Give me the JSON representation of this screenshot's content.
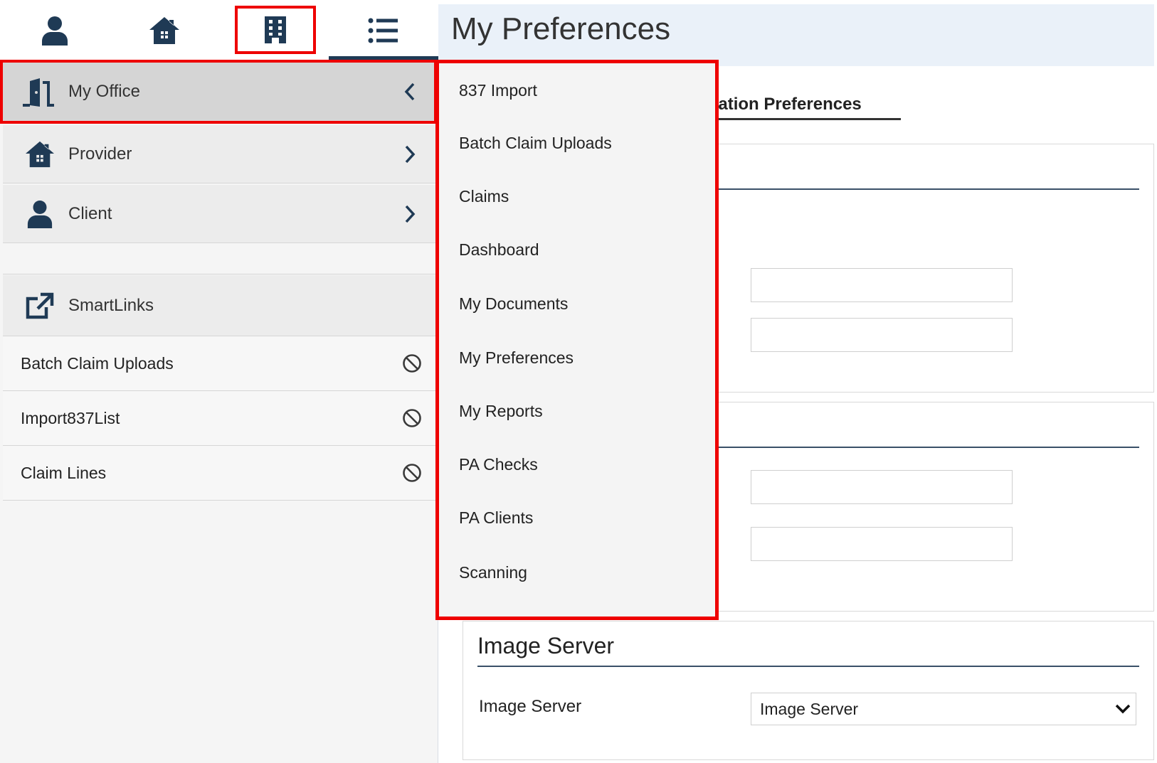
{
  "app": {
    "page_title": "My Preferences"
  },
  "top_icons": [
    {
      "name": "person-icon"
    },
    {
      "name": "house-icon"
    },
    {
      "name": "building-icon",
      "selected": true
    },
    {
      "name": "list-icon",
      "active_tab": true
    }
  ],
  "nav": {
    "items": [
      {
        "label": "My Office",
        "icon": "office-door-icon",
        "chevron": "chevron-left",
        "expanded": true
      },
      {
        "label": "Provider",
        "icon": "house-icon",
        "chevron": "chevron-right"
      },
      {
        "label": "Client",
        "icon": "person-icon",
        "chevron": "chevron-right"
      }
    ],
    "smartlinks": {
      "label": "SmartLinks",
      "icon": "external-link-icon",
      "items": [
        {
          "label": "Batch Claim Uploads",
          "icon": "ban-icon"
        },
        {
          "label": "Import837List",
          "icon": "ban-icon"
        },
        {
          "label": "Claim Lines",
          "icon": "ban-icon"
        }
      ]
    }
  },
  "submenu": {
    "items": [
      "837 Import",
      "Batch Claim Uploads",
      "Claims",
      "Dashboard",
      "My Documents",
      "My Preferences",
      "My Reports",
      "PA Checks",
      "PA Clients",
      "Scanning"
    ]
  },
  "main": {
    "active_tab_label": "cation Preferences",
    "image_server_section": {
      "title": "Image Server",
      "field_label": "Image Server",
      "select_value": "Image Server"
    }
  },
  "colors": {
    "highlight_red": "#ee0000",
    "icon_navy": "#1f3a55",
    "header_bg": "#eaf1f9"
  }
}
